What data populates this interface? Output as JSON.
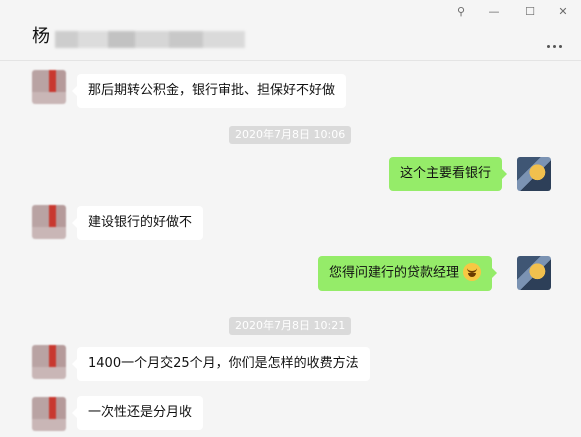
{
  "header": {
    "contact_name": "杨",
    "controls": [
      {
        "name": "pin",
        "glyph": "⚲"
      },
      {
        "name": "minimize",
        "glyph": "—"
      },
      {
        "name": "maximize",
        "glyph": "☐"
      },
      {
        "name": "close",
        "glyph": "✕"
      }
    ],
    "more_icon": "more-dots-icon"
  },
  "messages": [
    {
      "side": "left",
      "text": "那后期转公积金，银行审批、担保好不好做"
    },
    {
      "type": "timestamp",
      "text": "2020年7月8日 10:06"
    },
    {
      "side": "right",
      "text": "这个主要看银行"
    },
    {
      "side": "left",
      "text": "建设银行的好做不"
    },
    {
      "side": "right",
      "text": "您得问建行的贷款经理",
      "emoji": "laugh-crying-emoji"
    },
    {
      "type": "timestamp",
      "text": "2020年7月8日 10:21"
    },
    {
      "side": "left",
      "text": "1400一个月交25个月，你们是怎样的收费方法"
    },
    {
      "side": "left",
      "text": "一次性还是分月收"
    }
  ],
  "colors": {
    "right_bubble": "#95ec69",
    "left_bubble": "#ffffff",
    "background": "#f5f5f5"
  }
}
